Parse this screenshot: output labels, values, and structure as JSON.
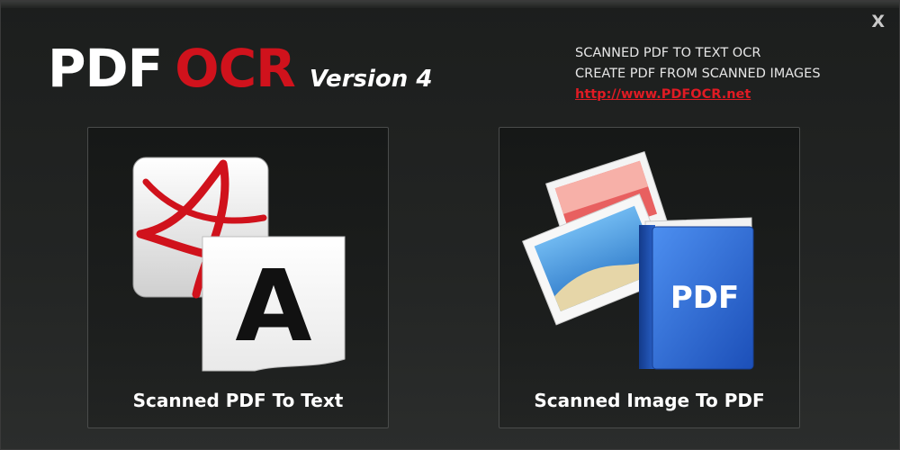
{
  "window": {
    "close_label": "X"
  },
  "header": {
    "title_pdf": "PDF",
    "title_ocr": "OCR",
    "version": "Version 4"
  },
  "info": {
    "line1": "SCANNED PDF TO TEXT OCR",
    "line2": "CREATE PDF FROM SCANNED IMAGES",
    "link": "http://www.PDFOCR.net"
  },
  "cards": [
    {
      "label": "Scanned PDF To Text",
      "icon": "pdf-to-text-icon",
      "icon_letter": "A"
    },
    {
      "label": "Scanned Image To PDF",
      "icon": "image-to-pdf-icon",
      "icon_text": "PDF"
    }
  ],
  "colors": {
    "accent_red": "#d0121c",
    "link_red": "#e01b24",
    "book_blue": "#2f6fd6"
  }
}
